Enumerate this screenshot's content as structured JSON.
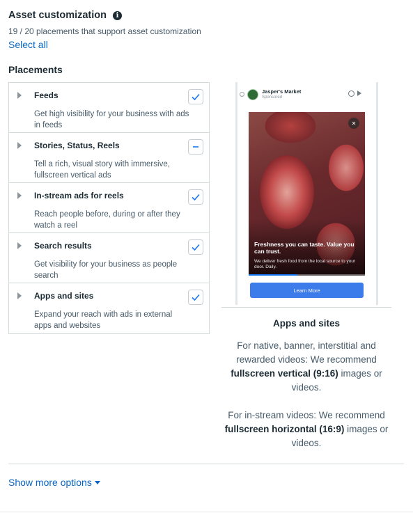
{
  "header": {
    "title": "Asset customization",
    "info_icon": "i",
    "subtitle": "19 / 20 placements that support asset customization",
    "select_all": "Select all"
  },
  "placements": {
    "title": "Placements",
    "items": [
      {
        "title": "Feeds",
        "description": "Get high visibility for your business with ads in feeds",
        "state": "checked"
      },
      {
        "title": "Stories, Status, Reels",
        "description": "Tell a rich, visual story with immersive, fullscreen vertical ads",
        "state": "indeterminate"
      },
      {
        "title": "In-stream ads for reels",
        "description": "Reach people before, during or after they watch a reel",
        "state": "checked"
      },
      {
        "title": "Search results",
        "description": "Get visibility for your business as people search",
        "state": "checked"
      },
      {
        "title": "Apps and sites",
        "description": "Expand your reach with ads in external apps and websites",
        "state": "checked"
      }
    ]
  },
  "preview": {
    "advertiser": "Jasper's Market",
    "sponsored": "Sponsored",
    "headline": "Freshness you can taste. Value you can trust.",
    "body": "We deliver fresh food from the local source to your door. Daily.",
    "cta": "Learn More",
    "video_progress": 0.42
  },
  "info": {
    "title": "Apps and sites",
    "p1_before": "For native, banner, interstitial and rewarded videos: We recommend ",
    "p1_bold": "fullscreen vertical (9:16)",
    "p1_after": " images or videos.",
    "p2_before": "For in-stream videos: We recommend ",
    "p2_bold": "fullscreen horizontal (16:9)",
    "p2_after": " images or videos."
  },
  "footer": {
    "show_more": "Show more options"
  },
  "colors": {
    "link": "#0a66c2",
    "check": "#1877f2",
    "text": "#1c2b33",
    "muted": "#465a69",
    "border": "#d3d8db"
  }
}
